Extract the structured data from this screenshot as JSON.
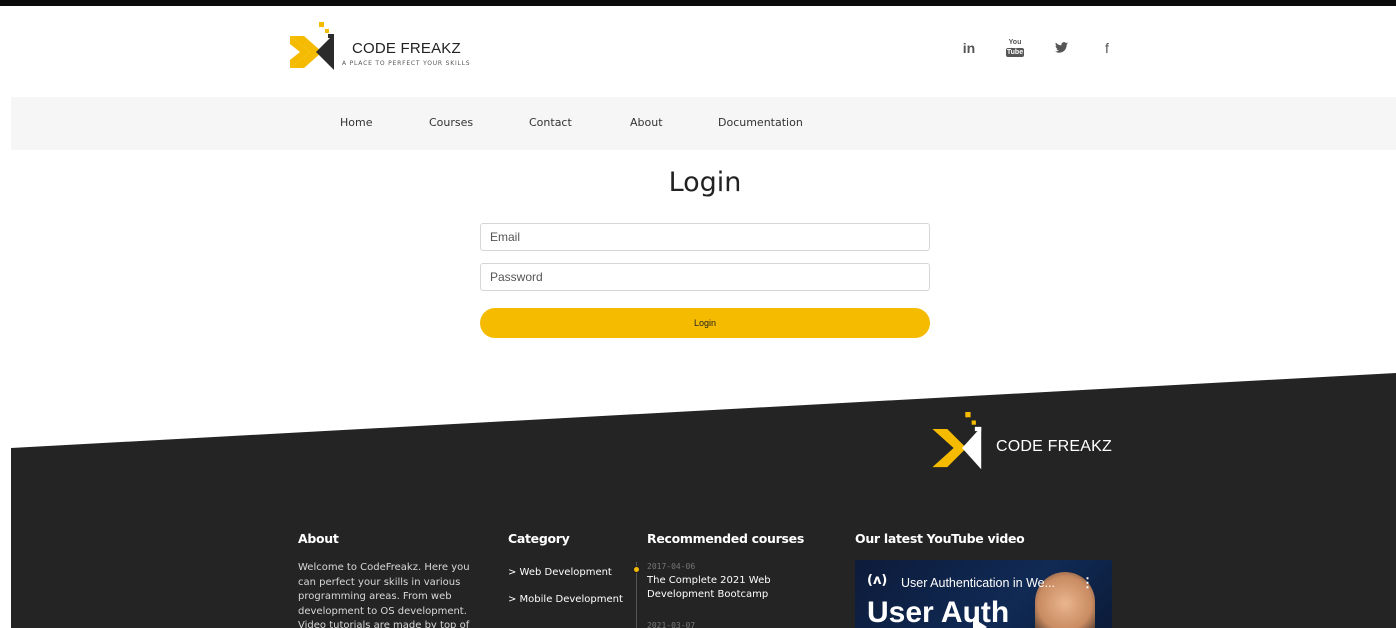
{
  "header": {
    "logo_title": "CODE FREAKZ",
    "logo_tagline": "A PLACE TO PERFECT YOUR SKILLS",
    "social": {
      "linkedin": "in",
      "youtube_top": "You",
      "youtube_bottom": "Tube",
      "twitter_icon": "twitter-bird-icon",
      "facebook": "f"
    }
  },
  "nav": {
    "items": [
      {
        "label": "Home"
      },
      {
        "label": "Courses"
      },
      {
        "label": "Contact"
      },
      {
        "label": "About"
      },
      {
        "label": "Documentation"
      }
    ]
  },
  "login": {
    "title": "Login",
    "email_placeholder": "Email",
    "password_placeholder": "Password",
    "button_label": "Login"
  },
  "footer": {
    "logo_title": "CODE FREAKZ",
    "about": {
      "title": "About",
      "text": "Welcome to CodeFreakz. Here you can perfect your skills in various programming areas. From web development to OS development. Video tutorials are made by top of"
    },
    "category": {
      "title": "Category",
      "items": [
        {
          "label": "> Web Development"
        },
        {
          "label": "> Mobile Development"
        }
      ]
    },
    "recommended": {
      "title": "Recommended courses",
      "items": [
        {
          "date": "2017-04-06",
          "title": "The Complete 2021 Web Development Bootcamp"
        },
        {
          "date": "2021-03-07",
          "title": ""
        }
      ]
    },
    "youtube": {
      "title": "Our latest YouTube video",
      "video_badge": "(ʌ)",
      "video_title": "User Authentication in We...",
      "video_menu": "⋮",
      "video_big_text": "User Auth"
    }
  },
  "colors": {
    "accent": "#f4bb00",
    "footer_bg": "#242424",
    "nav_bg": "#f6f6f6",
    "topbar": "#0a0a0a"
  }
}
